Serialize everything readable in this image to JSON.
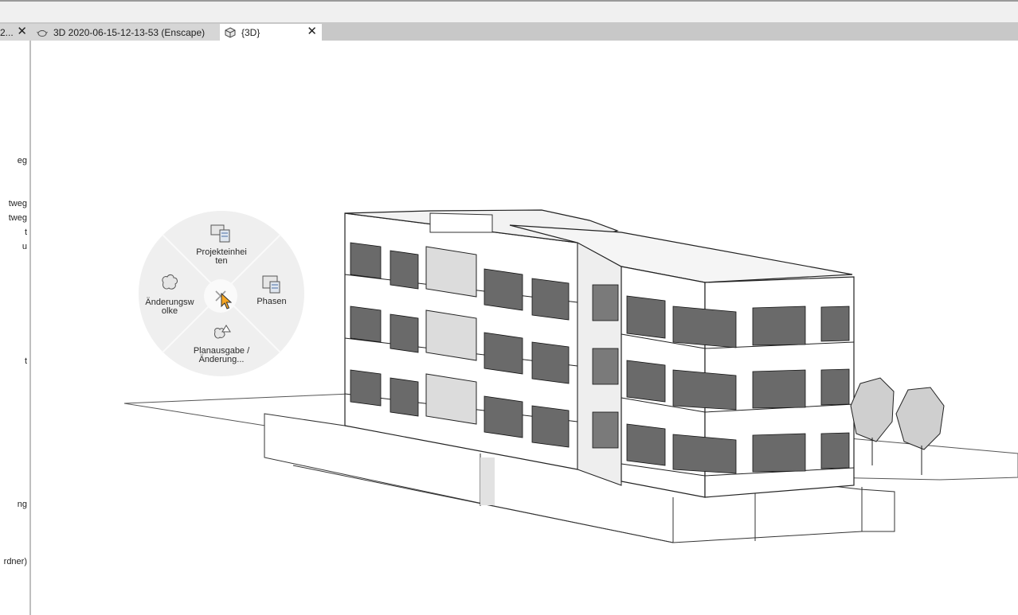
{
  "tabs": [
    {
      "label": "2...",
      "active": false
    },
    {
      "label": "3D 2020-06-15-12-13-53 (Enscape)",
      "active": false,
      "icon": "teapot-render-icon"
    },
    {
      "label": "{3D}",
      "active": true,
      "icon": "3d-cube-icon"
    }
  ],
  "left_panel": {
    "items": [
      "eg",
      "tweg",
      "tweg",
      "t",
      "u",
      "t",
      "ng",
      "rdner)"
    ]
  },
  "radial_menu": {
    "top": "Projekteinhei ten",
    "right": "Phasen",
    "bottom": "Planausgabe /Änderung...",
    "left": "Änderungsw olke",
    "center_icon": "close-icon"
  },
  "colors": {
    "tabstrip": "#c8c8c8",
    "active_tab": "#ffffff",
    "inactive_tab": "#d6d6d6",
    "wheel": "#efefef",
    "cursor": "#f5a623"
  }
}
